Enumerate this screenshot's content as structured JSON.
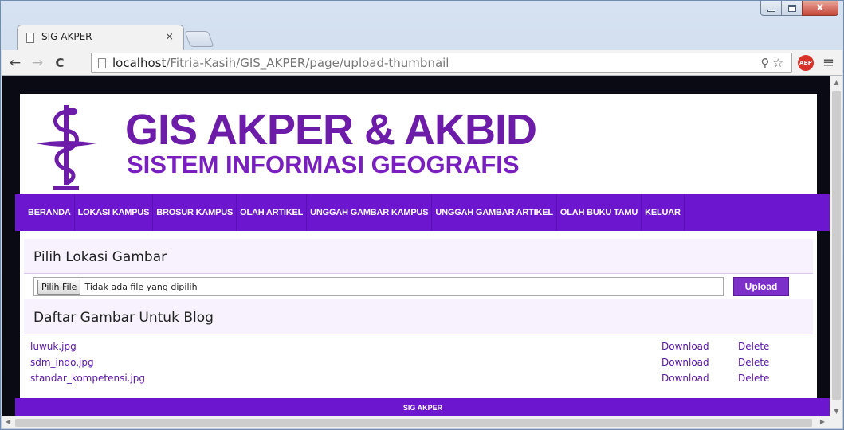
{
  "browser": {
    "tab_title": "SIG AKPER",
    "tab_close": "×",
    "url_host": "localhost",
    "url_path": "/Fitria-Kasih/GIS_AKPER/page/upload-thumbnail",
    "back": "←",
    "forward": "→",
    "reload": "C",
    "zoom_icon": "⚲",
    "star_icon": "☆",
    "abp_label": "ABP",
    "menu_icon": "≡",
    "close_glyph": "x"
  },
  "header": {
    "title": "GIS AKPER & AKBID",
    "subtitle": "SISTEM INFORMASI GEOGRAFIS"
  },
  "nav": [
    "BERANDA",
    "LOKASI KAMPUS",
    "BROSUR KAMPUS",
    "OLAH ARTIKEL",
    "UNGGAH GAMBAR KAMPUS",
    "UNGGAH GAMBAR ARTIKEL",
    "OLAH BUKU TAMU",
    "KELUAR"
  ],
  "upload": {
    "heading": "Pilih Lokasi Gambar",
    "file_button": "Pilih File",
    "file_status": "Tidak ada file yang dipilih",
    "upload_button": "Upload"
  },
  "list": {
    "heading": "Daftar Gambar Untuk Blog",
    "download_label": "Download",
    "delete_label": "Delete",
    "files": [
      "luwuk.jpg",
      "sdm_indo.jpg",
      "standar_kompetensi.jpg"
    ]
  },
  "footer": {
    "text": "SIG AKPER"
  },
  "colors": {
    "brand": "#6c1ca8",
    "nav_bg": "#6d16cf",
    "link": "#5a16a8"
  }
}
